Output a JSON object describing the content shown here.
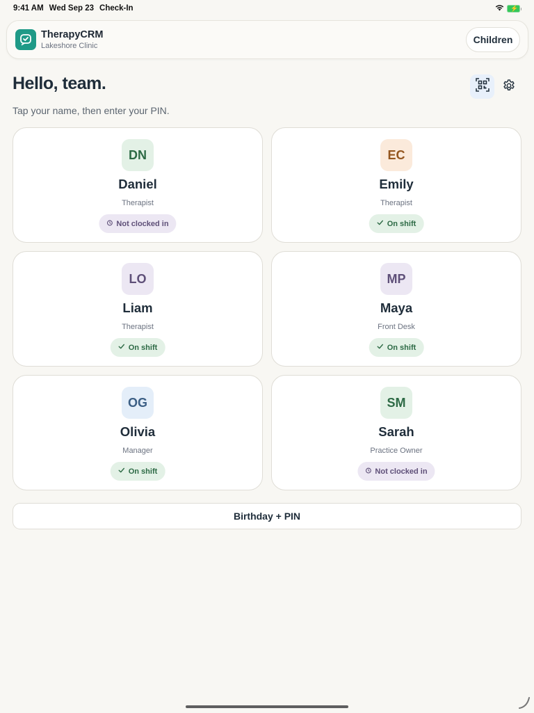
{
  "status_bar": {
    "time": "9:41 AM",
    "date": "Wed Sep 23",
    "app_name": "Check-In",
    "icons": [
      "wifi-icon",
      "battery-charging-icon"
    ],
    "battery_color": "#34c759"
  },
  "header": {
    "app_title": "TherapyCRM",
    "clinic": "Lakeshore Clinic",
    "children_button": "Children",
    "logo_icon": "chat-app-logo",
    "logo_color": "#1f9a87"
  },
  "main": {
    "greeting": "Hello, team.",
    "instructions": "Tap your name, then enter your PIN.",
    "qr_icon": "qr-code-icon",
    "settings_icon": "gear-icon"
  },
  "staff": [
    {
      "initials": "DN",
      "name": "Daniel",
      "role": "Therapist",
      "status": "Not clocked in",
      "status_icon": "clock-icon",
      "avatar_bg": "#e3f1e6",
      "avatar_fg": "#2d6a45"
    },
    {
      "initials": "EC",
      "name": "Emily",
      "role": "Therapist",
      "status": "On shift",
      "status_icon": "check-icon",
      "avatar_bg": "#fbeadb",
      "avatar_fg": "#94561f"
    },
    {
      "initials": "LO",
      "name": "Liam",
      "role": "Therapist",
      "status": "On shift",
      "status_icon": "check-icon",
      "avatar_bg": "#ece7f3",
      "avatar_fg": "#5e4f78"
    },
    {
      "initials": "MP",
      "name": "Maya",
      "role": "Front Desk",
      "status": "On shift",
      "status_icon": "check-icon",
      "avatar_bg": "#ece7f3",
      "avatar_fg": "#5e4f78"
    },
    {
      "initials": "OG",
      "name": "Olivia",
      "role": "Manager",
      "status": "On shift",
      "status_icon": "check-icon",
      "avatar_bg": "#e4eef9",
      "avatar_fg": "#3c5f85"
    },
    {
      "initials": "SM",
      "name": "Sarah",
      "role": "Practice Owner",
      "status": "Not clocked in",
      "status_icon": "clock-icon",
      "avatar_bg": "#e3f1e6",
      "avatar_fg": "#2d6a45"
    }
  ],
  "footer": {
    "birthday_pin_button": "Birthday + PIN"
  }
}
